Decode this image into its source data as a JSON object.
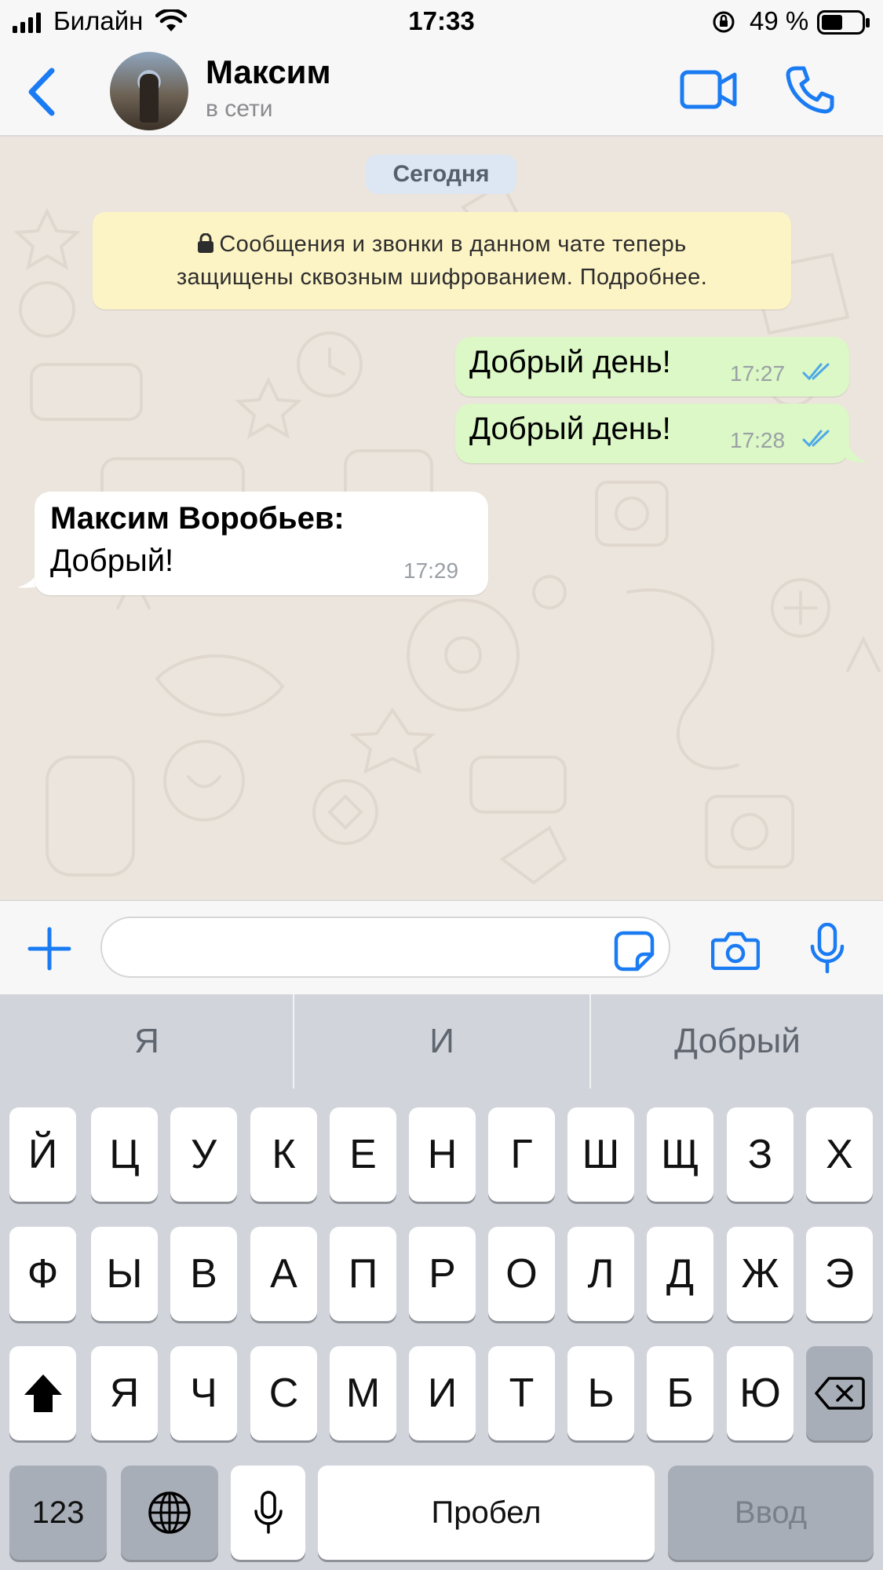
{
  "status_bar": {
    "carrier": "Билайн",
    "time": "17:33",
    "battery": "49 %"
  },
  "header": {
    "contact_name": "Максим",
    "contact_status": "в сети",
    "icons": [
      "chevron-left-icon",
      "video-call-icon",
      "phone-icon"
    ],
    "accent_color": "#1a7bf3"
  },
  "chat": {
    "date_label": "Сегодня",
    "encryption_notice_line1": "Сообщения и звонки в данном чате теперь",
    "encryption_notice_line2": "защищены сквозным шифрованием. Подробнее.",
    "messages": [
      {
        "direction": "outgoing",
        "text": "Добрый день!",
        "time": "17:27",
        "status": "read"
      },
      {
        "direction": "outgoing",
        "text": "Добрый день!",
        "time": "17:28",
        "status": "read"
      },
      {
        "direction": "incoming",
        "sender": "Максим Воробьев:",
        "text": "Добрый!",
        "time": "17:29"
      }
    ]
  },
  "composer": {
    "placeholder": "",
    "icons": [
      "plus-icon",
      "sticker-icon",
      "camera-icon",
      "microphone-icon"
    ]
  },
  "suggestions": [
    "Я",
    "И",
    "Добрый"
  ],
  "keyboard": {
    "row1": [
      "Й",
      "Ц",
      "У",
      "К",
      "Е",
      "Н",
      "Г",
      "Ш",
      "Щ",
      "З",
      "Х"
    ],
    "row2": [
      "Ф",
      "Ы",
      "В",
      "А",
      "П",
      "Р",
      "О",
      "Л",
      "Д",
      "Ж",
      "Э"
    ],
    "row3": [
      "Я",
      "Ч",
      "С",
      "М",
      "И",
      "Т",
      "Ь",
      "Б",
      "Ю"
    ],
    "numbers_label": "123",
    "space_label": "Пробел",
    "return_label": "Ввод"
  }
}
